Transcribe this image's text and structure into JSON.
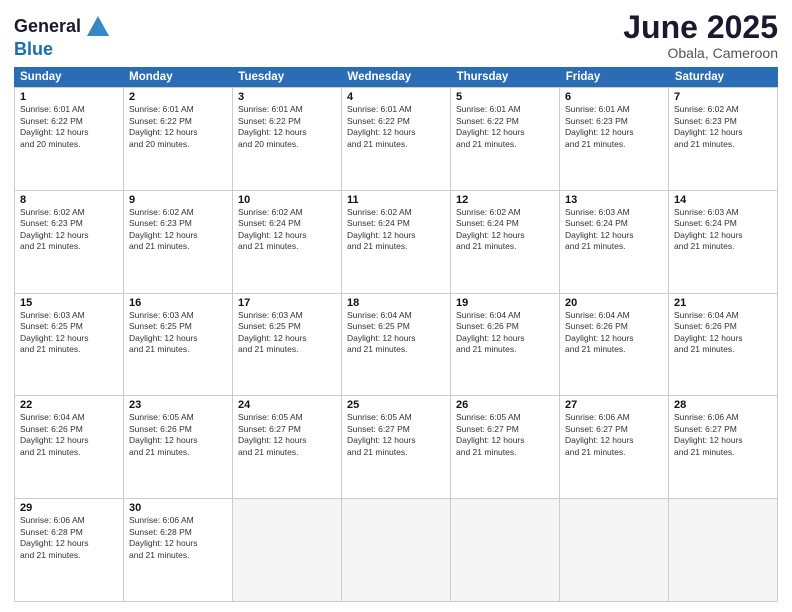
{
  "header": {
    "logo_line1": "General",
    "logo_line2": "Blue",
    "month": "June 2025",
    "location": "Obala, Cameroon"
  },
  "weekdays": [
    "Sunday",
    "Monday",
    "Tuesday",
    "Wednesday",
    "Thursday",
    "Friday",
    "Saturday"
  ],
  "rows": [
    [
      {
        "day": "1",
        "info": "Sunrise: 6:01 AM\nSunset: 6:22 PM\nDaylight: 12 hours\nand 20 minutes."
      },
      {
        "day": "2",
        "info": "Sunrise: 6:01 AM\nSunset: 6:22 PM\nDaylight: 12 hours\nand 20 minutes."
      },
      {
        "day": "3",
        "info": "Sunrise: 6:01 AM\nSunset: 6:22 PM\nDaylight: 12 hours\nand 20 minutes."
      },
      {
        "day": "4",
        "info": "Sunrise: 6:01 AM\nSunset: 6:22 PM\nDaylight: 12 hours\nand 21 minutes."
      },
      {
        "day": "5",
        "info": "Sunrise: 6:01 AM\nSunset: 6:22 PM\nDaylight: 12 hours\nand 21 minutes."
      },
      {
        "day": "6",
        "info": "Sunrise: 6:01 AM\nSunset: 6:23 PM\nDaylight: 12 hours\nand 21 minutes."
      },
      {
        "day": "7",
        "info": "Sunrise: 6:02 AM\nSunset: 6:23 PM\nDaylight: 12 hours\nand 21 minutes."
      }
    ],
    [
      {
        "day": "8",
        "info": "Sunrise: 6:02 AM\nSunset: 6:23 PM\nDaylight: 12 hours\nand 21 minutes."
      },
      {
        "day": "9",
        "info": "Sunrise: 6:02 AM\nSunset: 6:23 PM\nDaylight: 12 hours\nand 21 minutes."
      },
      {
        "day": "10",
        "info": "Sunrise: 6:02 AM\nSunset: 6:24 PM\nDaylight: 12 hours\nand 21 minutes."
      },
      {
        "day": "11",
        "info": "Sunrise: 6:02 AM\nSunset: 6:24 PM\nDaylight: 12 hours\nand 21 minutes."
      },
      {
        "day": "12",
        "info": "Sunrise: 6:02 AM\nSunset: 6:24 PM\nDaylight: 12 hours\nand 21 minutes."
      },
      {
        "day": "13",
        "info": "Sunrise: 6:03 AM\nSunset: 6:24 PM\nDaylight: 12 hours\nand 21 minutes."
      },
      {
        "day": "14",
        "info": "Sunrise: 6:03 AM\nSunset: 6:24 PM\nDaylight: 12 hours\nand 21 minutes."
      }
    ],
    [
      {
        "day": "15",
        "info": "Sunrise: 6:03 AM\nSunset: 6:25 PM\nDaylight: 12 hours\nand 21 minutes."
      },
      {
        "day": "16",
        "info": "Sunrise: 6:03 AM\nSunset: 6:25 PM\nDaylight: 12 hours\nand 21 minutes."
      },
      {
        "day": "17",
        "info": "Sunrise: 6:03 AM\nSunset: 6:25 PM\nDaylight: 12 hours\nand 21 minutes."
      },
      {
        "day": "18",
        "info": "Sunrise: 6:04 AM\nSunset: 6:25 PM\nDaylight: 12 hours\nand 21 minutes."
      },
      {
        "day": "19",
        "info": "Sunrise: 6:04 AM\nSunset: 6:26 PM\nDaylight: 12 hours\nand 21 minutes."
      },
      {
        "day": "20",
        "info": "Sunrise: 6:04 AM\nSunset: 6:26 PM\nDaylight: 12 hours\nand 21 minutes."
      },
      {
        "day": "21",
        "info": "Sunrise: 6:04 AM\nSunset: 6:26 PM\nDaylight: 12 hours\nand 21 minutes."
      }
    ],
    [
      {
        "day": "22",
        "info": "Sunrise: 6:04 AM\nSunset: 6:26 PM\nDaylight: 12 hours\nand 21 minutes."
      },
      {
        "day": "23",
        "info": "Sunrise: 6:05 AM\nSunset: 6:26 PM\nDaylight: 12 hours\nand 21 minutes."
      },
      {
        "day": "24",
        "info": "Sunrise: 6:05 AM\nSunset: 6:27 PM\nDaylight: 12 hours\nand 21 minutes."
      },
      {
        "day": "25",
        "info": "Sunrise: 6:05 AM\nSunset: 6:27 PM\nDaylight: 12 hours\nand 21 minutes."
      },
      {
        "day": "26",
        "info": "Sunrise: 6:05 AM\nSunset: 6:27 PM\nDaylight: 12 hours\nand 21 minutes."
      },
      {
        "day": "27",
        "info": "Sunrise: 6:06 AM\nSunset: 6:27 PM\nDaylight: 12 hours\nand 21 minutes."
      },
      {
        "day": "28",
        "info": "Sunrise: 6:06 AM\nSunset: 6:27 PM\nDaylight: 12 hours\nand 21 minutes."
      }
    ],
    [
      {
        "day": "29",
        "info": "Sunrise: 6:06 AM\nSunset: 6:28 PM\nDaylight: 12 hours\nand 21 minutes."
      },
      {
        "day": "30",
        "info": "Sunrise: 6:06 AM\nSunset: 6:28 PM\nDaylight: 12 hours\nand 21 minutes."
      },
      {
        "day": "",
        "info": ""
      },
      {
        "day": "",
        "info": ""
      },
      {
        "day": "",
        "info": ""
      },
      {
        "day": "",
        "info": ""
      },
      {
        "day": "",
        "info": ""
      }
    ]
  ]
}
